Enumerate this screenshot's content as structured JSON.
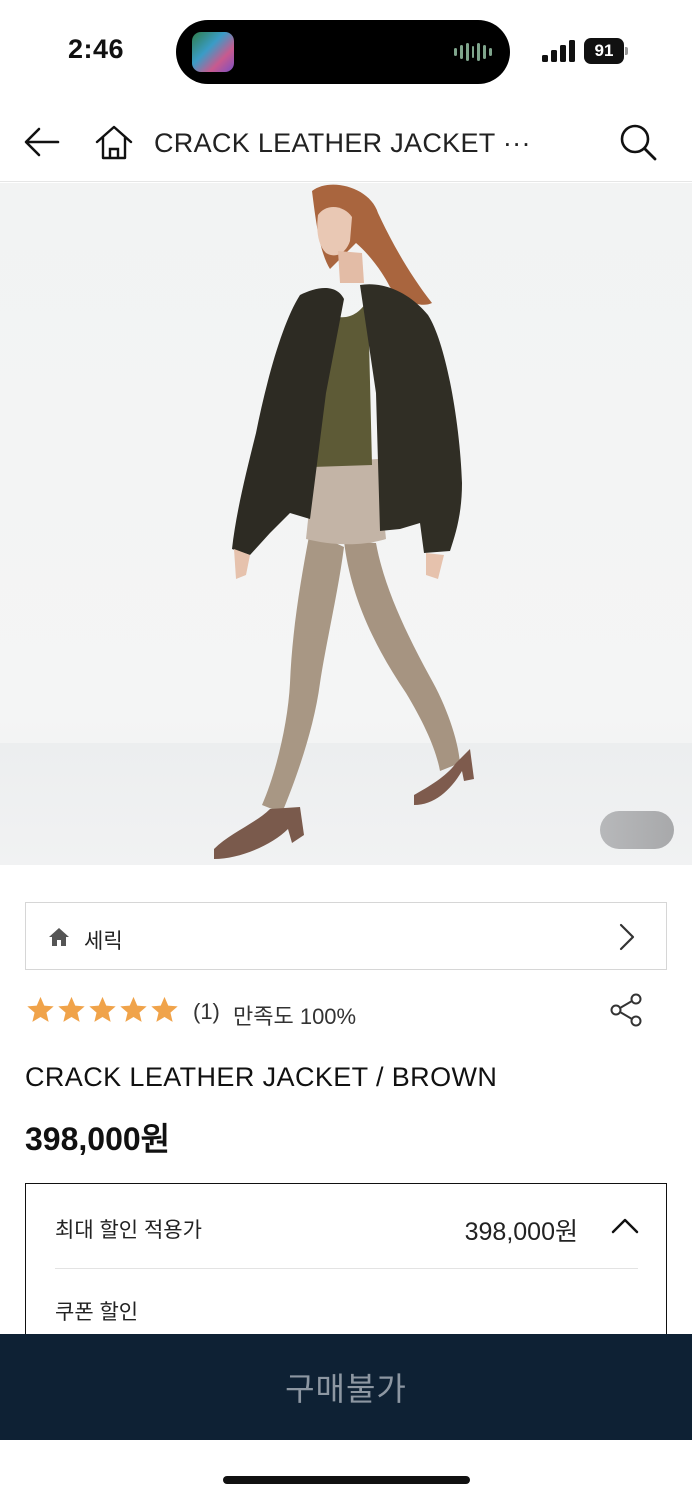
{
  "status_bar": {
    "time": "2:46",
    "battery": "91"
  },
  "header": {
    "title": "CRACK LEATHER JACKET ···",
    "back_icon": "arrow-left-icon",
    "home_icon": "home-icon",
    "search_icon": "search-icon"
  },
  "product_image": {
    "alt": "Model wearing crack leather jacket",
    "pager_indicator": ""
  },
  "brand": {
    "name": "세릭",
    "icon": "home-icon"
  },
  "rating": {
    "stars": 5,
    "review_count": "(1)",
    "satisfaction": "만족도 100%",
    "star_color": "#f0a34a"
  },
  "product": {
    "name": "CRACK LEATHER JACKET / BROWN",
    "price": "398,000원"
  },
  "discount": {
    "label": "최대 할인 적용가",
    "value": "398,000원",
    "coupon_label": "쿠폰 할인"
  },
  "buy_bar": {
    "label": "구매불가",
    "background": "#0e2134"
  }
}
